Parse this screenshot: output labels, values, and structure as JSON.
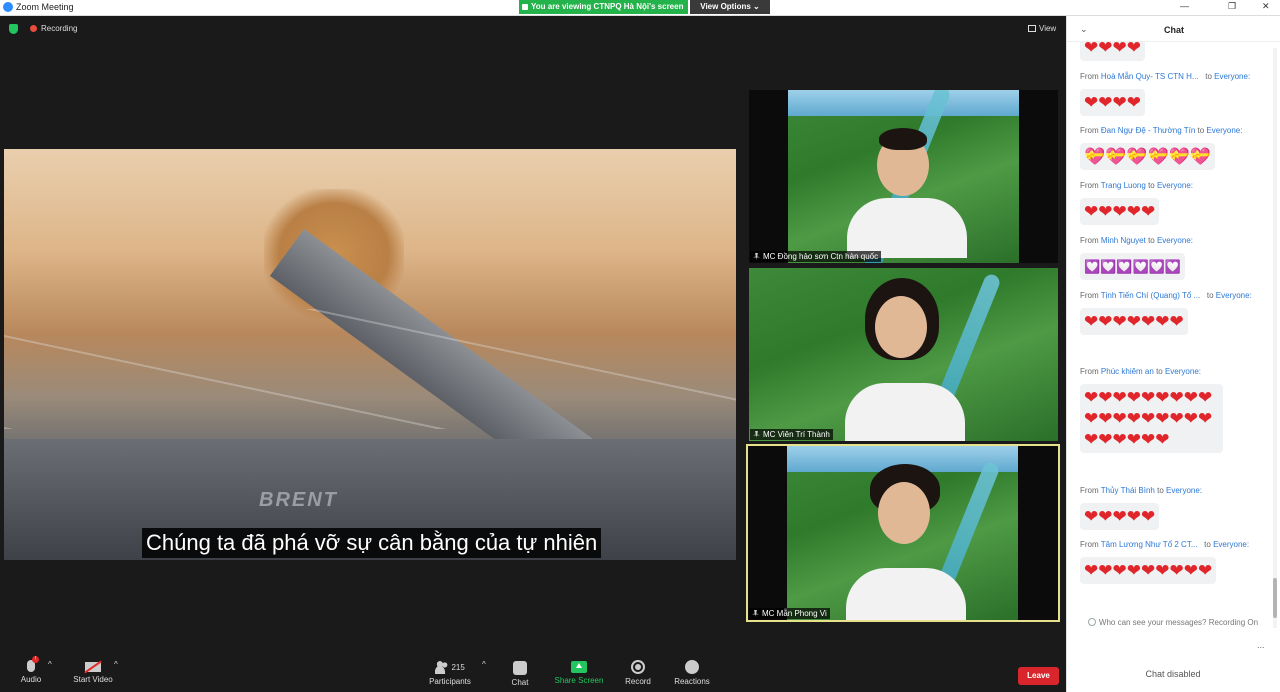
{
  "window": {
    "title": "Zoom Meeting"
  },
  "banner": {
    "text": "You are viewing CTNPQ Hà Nội's screen",
    "view_options": "View Options ⌄"
  },
  "meeting": {
    "recording_label": "Recording",
    "view_label": "View"
  },
  "shared_screen": {
    "subtitle": "Chúng ta đã phá vỡ sự cân bằng của tự nhiên",
    "truck_brand": "BRENT"
  },
  "participants": [
    {
      "name": "MC Đồng hảo sơn Ctn hàn quốc"
    },
    {
      "name": "MC Viên Trí Thành"
    },
    {
      "name": "MC Mẫn Phong Vi"
    }
  ],
  "toolbar": {
    "audio": "Audio",
    "audio_badge": "!",
    "start_video": "Start Video",
    "participants": "Participants",
    "participants_count": "215",
    "chat": "Chat",
    "share_screen": "Share Screen",
    "record": "Record",
    "reactions": "Reactions",
    "leave": "Leave"
  },
  "chat": {
    "title": "Chat",
    "top_partial": "❤❤❤❤",
    "messages": [
      {
        "from_prefix": "From",
        "sender": "Hoà Mẫn Quy- TS CTN H...",
        "to_prefix": "to",
        "recipient": "Everyone:",
        "content": "❤❤❤❤"
      },
      {
        "from_prefix": "From",
        "sender": "Đan Ngự Đệ - Thường Tín",
        "to_prefix": "to",
        "recipient": "Everyone:",
        "content": "💝💝💝💝💝💝"
      },
      {
        "from_prefix": "From",
        "sender": "Trang Luong",
        "to_prefix": "to",
        "recipient": "Everyone:",
        "content": "❤❤❤❤❤"
      },
      {
        "from_prefix": "From",
        "sender": "Minh Nguyet",
        "to_prefix": "to",
        "recipient": "Everyone:",
        "content": "💟💟💟💟💟💟"
      },
      {
        "from_prefix": "From",
        "sender": "Tịnh Tiến Chí (Quang) Tổ ...",
        "to_prefix": "to",
        "recipient": "Everyone:",
        "content": "❤❤❤❤❤❤❤"
      },
      {
        "from_prefix": "From",
        "sender": "Phúc khiêm an",
        "to_prefix": "to",
        "recipient": "Everyone:",
        "content": "❤❤❤❤❤❤❤❤❤❤❤❤❤❤❤❤❤❤❤❤❤❤❤❤"
      },
      {
        "from_prefix": "From",
        "sender": "Thủy Thái Bình",
        "to_prefix": "to",
        "recipient": "Everyone:",
        "content": "❤❤❤❤❤"
      },
      {
        "from_prefix": "From",
        "sender": "Tâm Lương Như Tổ 2 CT...",
        "to_prefix": "to",
        "recipient": "Everyone:",
        "content": "❤❤❤❤❤❤❤❤❤"
      }
    ],
    "visibility_notice": "Who can see your messages? Recording On",
    "more": "...",
    "disabled": "Chat disabled"
  }
}
